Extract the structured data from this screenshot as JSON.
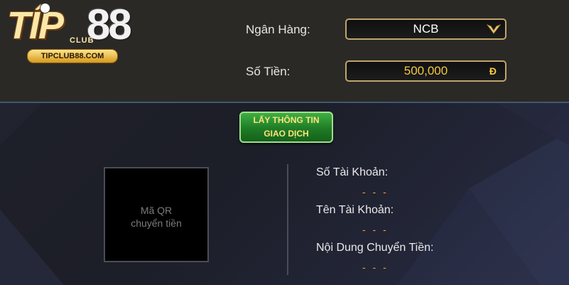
{
  "logo": {
    "tip": "TÍP",
    "club": "CLUB",
    "eighty_eight": "88",
    "url": "TIPCLUB88.COM"
  },
  "form": {
    "bank_label": "Ngân Hàng:",
    "bank_value": "NCB",
    "amount_label": "Số Tiền:",
    "amount_value": "500,000",
    "currency_symbol": "Đ"
  },
  "action_button": {
    "line1": "LẤY THÔNG TIN",
    "line2": "GIAO DỊCH"
  },
  "qr": {
    "line1": "Mã QR",
    "line2": "chuyển tiền"
  },
  "details": {
    "account_number_label": "Số Tài Khoản:",
    "account_number_value": "- - -",
    "account_name_label": "Tên Tài Khoản:",
    "account_name_value": "- - -",
    "transfer_content_label": "Nội Dung Chuyển Tiền:",
    "transfer_content_value": "- - -"
  },
  "colors": {
    "accent_gold": "#f5a623",
    "button_green": "#2a8f2f",
    "field_border": "#bfa56a"
  },
  "icons": {
    "dropdown": "chevron-down-icon",
    "currency": "dong-icon"
  }
}
